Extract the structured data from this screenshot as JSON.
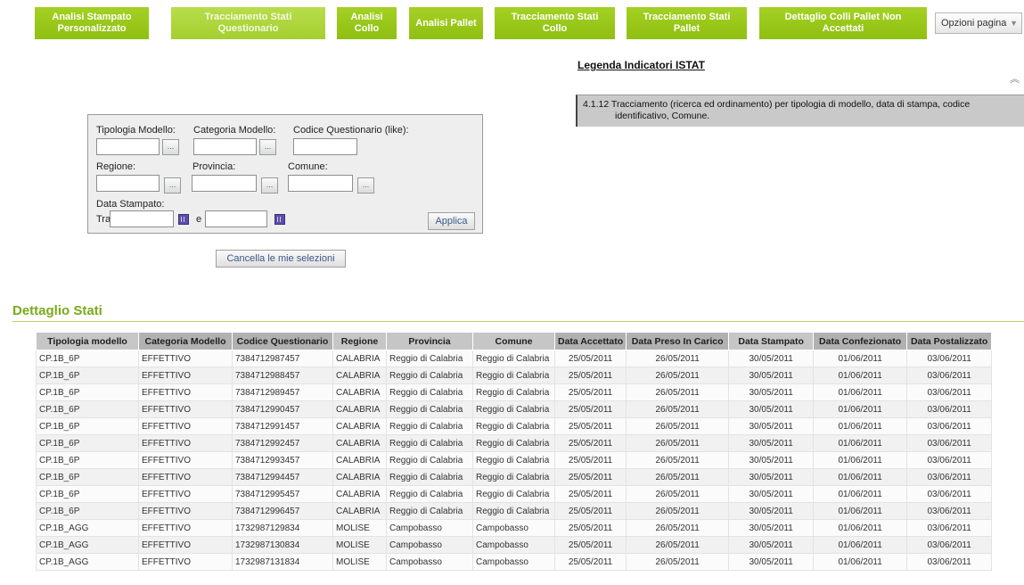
{
  "tabs": [
    {
      "label": "Analisi Stampato Personalizzato"
    },
    {
      "label": "Tracciamento Stati Questionario"
    },
    {
      "label": "Analisi Collo"
    },
    {
      "label": "Analisi Pallet"
    },
    {
      "label": "Tracciamento Stati Collo"
    },
    {
      "label": "Tracciamento Stati Pallet"
    },
    {
      "label": "Dettaglio Colli Pallet Non Accettati"
    }
  ],
  "page_options": {
    "label": "Opzioni pagina",
    "icon": "chevron-down-icon"
  },
  "legend": {
    "link": "Legenda Indicatori ISTAT",
    "collapse_icon": "double-chevron-up-icon",
    "text_line1": "4.1.12 Tracciamento (ricerca ed ordinamento) per tipologia di modello, data di stampa, codice",
    "text_line2": "identificativo, Comune."
  },
  "filters": {
    "tipologia_modello": {
      "label": "Tipologia Modello:",
      "value": ""
    },
    "categoria_modello": {
      "label": "Categoria Modello:",
      "value": ""
    },
    "codice_questionario": {
      "label": "Codice Questionario (like):",
      "value": ""
    },
    "regione": {
      "label": "Regione:",
      "value": ""
    },
    "provincia": {
      "label": "Provincia:",
      "value": ""
    },
    "comune": {
      "label": "Comune:",
      "value": ""
    },
    "data_stampato": {
      "label": "Data Stampato:",
      "tra": "Tra",
      "e": "e",
      "from": "",
      "to": ""
    },
    "picker_label": "...",
    "apply_label": "Applica",
    "clear_label": "Cancella le mie selezioni"
  },
  "section": {
    "title": "Dettaglio Stati"
  },
  "table": {
    "columns": [
      "Tipologia modello",
      "Categoria Modello",
      "Codice Questionario",
      "Regione",
      "Provincia",
      "Comune",
      "Data Accettato",
      "Data Preso In Carico",
      "Data Stampato",
      "Data Confezionato",
      "Data Postalizzato"
    ],
    "rows": [
      [
        "CP.1B_6P",
        "EFFETTIVO",
        "7384712987457",
        "CALABRIA",
        "Reggio di Calabria",
        "Reggio di Calabria",
        "25/05/2011",
        "26/05/2011",
        "30/05/2011",
        "01/06/2011",
        "03/06/2011"
      ],
      [
        "CP.1B_6P",
        "EFFETTIVO",
        "7384712988457",
        "CALABRIA",
        "Reggio di Calabria",
        "Reggio di Calabria",
        "25/05/2011",
        "26/05/2011",
        "30/05/2011",
        "01/06/2011",
        "03/06/2011"
      ],
      [
        "CP.1B_6P",
        "EFFETTIVO",
        "7384712989457",
        "CALABRIA",
        "Reggio di Calabria",
        "Reggio di Calabria",
        "25/05/2011",
        "26/05/2011",
        "30/05/2011",
        "01/06/2011",
        "03/06/2011"
      ],
      [
        "CP.1B_6P",
        "EFFETTIVO",
        "7384712990457",
        "CALABRIA",
        "Reggio di Calabria",
        "Reggio di Calabria",
        "25/05/2011",
        "26/05/2011",
        "30/05/2011",
        "01/06/2011",
        "03/06/2011"
      ],
      [
        "CP.1B_6P",
        "EFFETTIVO",
        "7384712991457",
        "CALABRIA",
        "Reggio di Calabria",
        "Reggio di Calabria",
        "25/05/2011",
        "26/05/2011",
        "30/05/2011",
        "01/06/2011",
        "03/06/2011"
      ],
      [
        "CP.1B_6P",
        "EFFETTIVO",
        "7384712992457",
        "CALABRIA",
        "Reggio di Calabria",
        "Reggio di Calabria",
        "25/05/2011",
        "26/05/2011",
        "30/05/2011",
        "01/06/2011",
        "03/06/2011"
      ],
      [
        "CP.1B_6P",
        "EFFETTIVO",
        "7384712993457",
        "CALABRIA",
        "Reggio di Calabria",
        "Reggio di Calabria",
        "25/05/2011",
        "26/05/2011",
        "30/05/2011",
        "01/06/2011",
        "03/06/2011"
      ],
      [
        "CP.1B_6P",
        "EFFETTIVO",
        "7384712994457",
        "CALABRIA",
        "Reggio di Calabria",
        "Reggio di Calabria",
        "25/05/2011",
        "26/05/2011",
        "30/05/2011",
        "01/06/2011",
        "03/06/2011"
      ],
      [
        "CP.1B_6P",
        "EFFETTIVO",
        "7384712995457",
        "CALABRIA",
        "Reggio di Calabria",
        "Reggio di Calabria",
        "25/05/2011",
        "26/05/2011",
        "30/05/2011",
        "01/06/2011",
        "03/06/2011"
      ],
      [
        "CP.1B_6P",
        "EFFETTIVO",
        "7384712996457",
        "CALABRIA",
        "Reggio di Calabria",
        "Reggio di Calabria",
        "25/05/2011",
        "26/05/2011",
        "30/05/2011",
        "01/06/2011",
        "03/06/2011"
      ],
      [
        "CP.1B_AGG",
        "EFFETTIVO",
        "1732987129834",
        "MOLISE",
        "Campobasso",
        "Campobasso",
        "25/05/2011",
        "26/05/2011",
        "30/05/2011",
        "01/06/2011",
        "03/06/2011"
      ],
      [
        "CP.1B_AGG",
        "EFFETTIVO",
        "1732987130834",
        "MOLISE",
        "Campobasso",
        "Campobasso",
        "25/05/2011",
        "26/05/2011",
        "30/05/2011",
        "01/06/2011",
        "03/06/2011"
      ],
      [
        "CP.1B_AGG",
        "EFFETTIVO",
        "1732987131834",
        "MOLISE",
        "Campobasso",
        "Campobasso",
        "25/05/2011",
        "26/05/2011",
        "30/05/2011",
        "01/06/2011",
        "03/06/2011"
      ]
    ]
  },
  "colors": {
    "tab_green": "#9ac31c",
    "section_title": "#7aa91a",
    "header_gray": "#b1b1b1"
  }
}
